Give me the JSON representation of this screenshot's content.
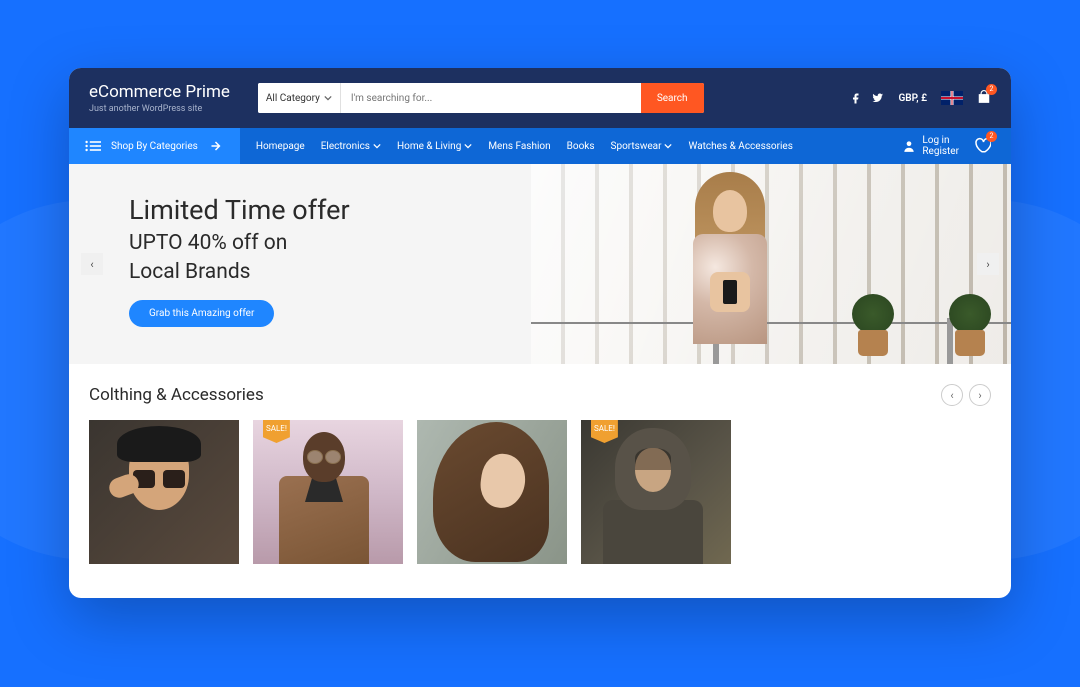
{
  "brand": {
    "title": "eCommerce Prime",
    "subtitle": "Just another WordPress site"
  },
  "search": {
    "category": "All Category",
    "placeholder": "I'm searching for...",
    "button": "Search"
  },
  "top": {
    "currency": "GBP, £",
    "cart_badge": "2"
  },
  "nav": {
    "shop_by": "Shop By Categories",
    "items": [
      {
        "label": "Homepage",
        "dd": false
      },
      {
        "label": "Electronics",
        "dd": true
      },
      {
        "label": "Home & Living",
        "dd": true
      },
      {
        "label": "Mens Fashion",
        "dd": false
      },
      {
        "label": "Books",
        "dd": false
      },
      {
        "label": "Sportswear",
        "dd": true
      },
      {
        "label": "Watches & Accessories",
        "dd": false
      }
    ],
    "login": "Log in",
    "register": "Register",
    "wish_badge": "2"
  },
  "hero": {
    "title": "Limited Time offer",
    "line1": "UPTO 40% off on",
    "line2": "Local Brands",
    "cta": "Grab this Amazing offer"
  },
  "products": {
    "title": "Colthing & Accessories",
    "sale_label": "SALE!",
    "items": [
      {
        "sale": false
      },
      {
        "sale": true
      },
      {
        "sale": false
      },
      {
        "sale": true
      }
    ]
  }
}
